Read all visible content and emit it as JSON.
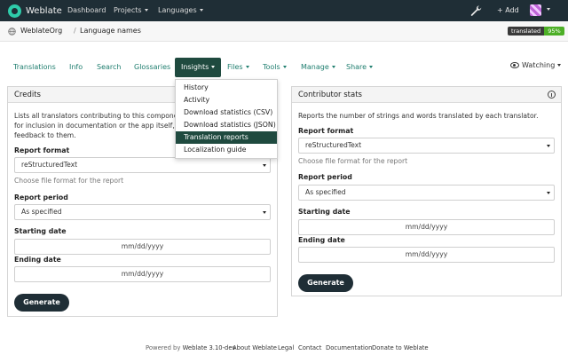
{
  "navbar": {
    "brand": "Weblate",
    "links": [
      "Dashboard",
      "Projects",
      "Languages"
    ],
    "add_label": "+ Add",
    "icons": {
      "logo": "weblate-logo",
      "tools": "wrench-icon",
      "user": "avatar"
    }
  },
  "breadcrumb": {
    "project": "WeblateOrg",
    "separator": "/",
    "component": "Language names",
    "badge_label": "translated",
    "badge_value": "95%"
  },
  "tabs": {
    "items": [
      "Translations",
      "Info",
      "Search",
      "Glossaries",
      "Insights",
      "Files",
      "Tools",
      "Manage",
      "Share"
    ],
    "active": "Insights",
    "watching": "Watching"
  },
  "insights_menu": {
    "items": [
      "History",
      "Activity",
      "Download statistics (CSV)",
      "Download statistics (JSON)",
      "Translation reports",
      "Localization guide"
    ],
    "highlighted": "Translation reports"
  },
  "credits": {
    "title": "Credits",
    "description_lines": [
      "Lists all translators contributing to this component",
      "for inclusion in documentation or the app itself, to th",
      "feedback to them."
    ],
    "report_format_label": "Report format",
    "report_format_value": "reStructuredText",
    "report_format_help": "Choose file format for the report",
    "report_period_label": "Report period",
    "report_period_value": "As specified",
    "starting_date_label": "Starting date",
    "starting_date_placeholder": "mm/dd/yyyy",
    "ending_date_label": "Ending date",
    "ending_date_placeholder": "mm/dd/yyyy",
    "generate_label": "Generate"
  },
  "contributor_stats": {
    "title": "Contributor stats",
    "description": "Reports the number of strings and words translated by each translator.",
    "report_format_label": "Report format",
    "report_format_value": "reStructuredText",
    "report_format_help": "Choose file format for the report",
    "report_period_label": "Report period",
    "report_period_value": "As specified",
    "starting_date_label": "Starting date",
    "starting_date_placeholder": "mm/dd/yyyy",
    "ending_date_label": "Ending date",
    "ending_date_placeholder": "mm/dd/yyyy",
    "generate_label": "Generate"
  },
  "footer": {
    "powered_prefix": "Powered by",
    "powered_link": "Weblate 3.10-dev",
    "links": [
      "About Weblate",
      "Legal",
      "Contact",
      "Documentation",
      "Donate to Weblate"
    ]
  },
  "colors": {
    "navbar_bg": "#1f2e36",
    "accent": "#1f7e6f",
    "active_tab": "#1f4a3f",
    "badge_green": "#4caf26"
  }
}
